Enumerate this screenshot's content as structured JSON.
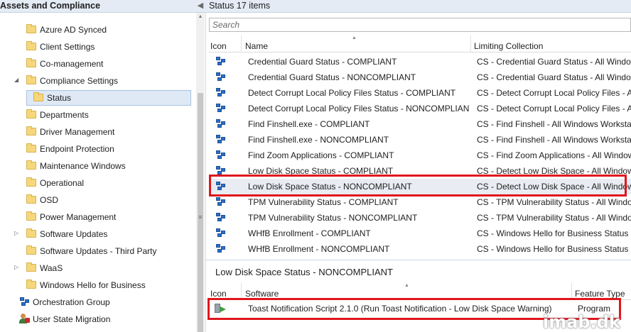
{
  "nav": {
    "title": "Assets and Compliance",
    "collapse_glyph": "◀",
    "items": [
      {
        "label": "Azure AD Synced",
        "expander": ""
      },
      {
        "label": "Client Settings",
        "expander": ""
      },
      {
        "label": "Co-management",
        "expander": ""
      },
      {
        "label": "Compliance Settings",
        "expander": "◢"
      },
      {
        "label": "Status",
        "expander": "",
        "selected": true
      },
      {
        "label": "Departments",
        "expander": ""
      },
      {
        "label": "Driver Management",
        "expander": ""
      },
      {
        "label": "Endpoint Protection",
        "expander": ""
      },
      {
        "label": "Maintenance Windows",
        "expander": ""
      },
      {
        "label": "Operational",
        "expander": ""
      },
      {
        "label": "OSD",
        "expander": ""
      },
      {
        "label": "Power Management",
        "expander": ""
      },
      {
        "label": "Software Updates",
        "expander": "▷"
      },
      {
        "label": "Software Updates - Third Party",
        "expander": ""
      },
      {
        "label": "WaaS",
        "expander": "▷"
      },
      {
        "label": "Windows Hello for Business",
        "expander": ""
      },
      {
        "label": "Orchestration Group",
        "expander": ""
      },
      {
        "label": "User State Migration",
        "expander": ""
      }
    ]
  },
  "content": {
    "title": "Status 17 items",
    "search_placeholder": "Search",
    "columns": {
      "icon": "Icon",
      "name": "Name",
      "collection": "Limiting Collection"
    },
    "rows": [
      {
        "name": "Credential Guard Status - COMPLIANT",
        "collection": "CS - Credential Guard Status - All Windows"
      },
      {
        "name": "Credential Guard Status - NONCOMPLIANT",
        "collection": "CS - Credential Guard Status - All Windows"
      },
      {
        "name": "Detect Corrupt Local Policy Files Status - COMPLIANT",
        "collection": "CS - Detect Corrupt Local Policy Files - All"
      },
      {
        "name": "Detect Corrupt Local Policy Files Status - NONCOMPLIANT",
        "collection": "CS - Detect Corrupt Local Policy Files - All"
      },
      {
        "name": "Find Finshell.exe - COMPLIANT",
        "collection": "CS - Find Finshell - All Windows Workstations"
      },
      {
        "name": "Find Finshell.exe - NONCOMPLIANT",
        "collection": "CS - Find Finshell - All Windows Workstations"
      },
      {
        "name": "Find Zoom Applications - COMPLIANT",
        "collection": "CS - Find Zoom Applications - All Windows"
      },
      {
        "name": "Low Disk Space Status - COMPLIANT",
        "collection": "CS - Detect Low Disk Space - All Windows"
      },
      {
        "name": "Low Disk Space Status - NONCOMPLIANT",
        "collection": "CS - Detect Low Disk Space - All Windows",
        "selected": true
      },
      {
        "name": "TPM Vulnerability Status - COMPLIANT",
        "collection": "CS - TPM Vulnerability Status - All Windows"
      },
      {
        "name": "TPM Vulnerability Status - NONCOMPLIANT",
        "collection": "CS - TPM Vulnerability Status - All Windows"
      },
      {
        "name": "WHfB Enrollment - COMPLIANT",
        "collection": "CS - Windows Hello for Business Status - All"
      },
      {
        "name": "WHfB Enrollment - NONCOMPLIANT",
        "collection": "CS - Windows Hello for Business Status - All"
      }
    ]
  },
  "details": {
    "title": "Low Disk Space Status - NONCOMPLIANT",
    "columns": {
      "icon": "Icon",
      "software": "Software",
      "feature": "Feature Type"
    },
    "row": {
      "software": "Toast Notification Script 2.1.0 (Run Toast Notification - Low Disk Space Warning)",
      "feature": "Program"
    }
  },
  "highlight_color": "#e0161b",
  "watermark": "imab.dk"
}
